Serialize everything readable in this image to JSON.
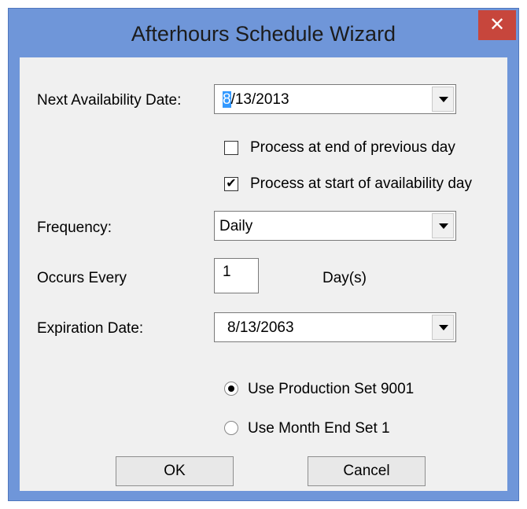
{
  "window": {
    "title": "Afterhours Schedule Wizard",
    "close_glyph": "✕"
  },
  "form": {
    "next_availability": {
      "label": "Next Availability Date:",
      "value_selected": "8",
      "value_rest": "/13/2013"
    },
    "process_end_prev": {
      "label": "Process at end of previous day",
      "checked": false
    },
    "process_start_avail": {
      "label": "Process at start of availability day",
      "checked": true,
      "check_glyph": "✔"
    },
    "frequency": {
      "label": "Frequency:",
      "value": "Daily"
    },
    "occurs_every": {
      "label": "Occurs Every",
      "value": "1",
      "unit": "Day(s)"
    },
    "expiration": {
      "label": "Expiration Date:",
      "value": "8/13/2063"
    },
    "radio_production": {
      "label": "Use Production Set 9001",
      "selected": true
    },
    "radio_month_end": {
      "label": "Use Month End Set 1",
      "selected": false
    }
  },
  "buttons": {
    "ok": "OK",
    "cancel": "Cancel"
  }
}
